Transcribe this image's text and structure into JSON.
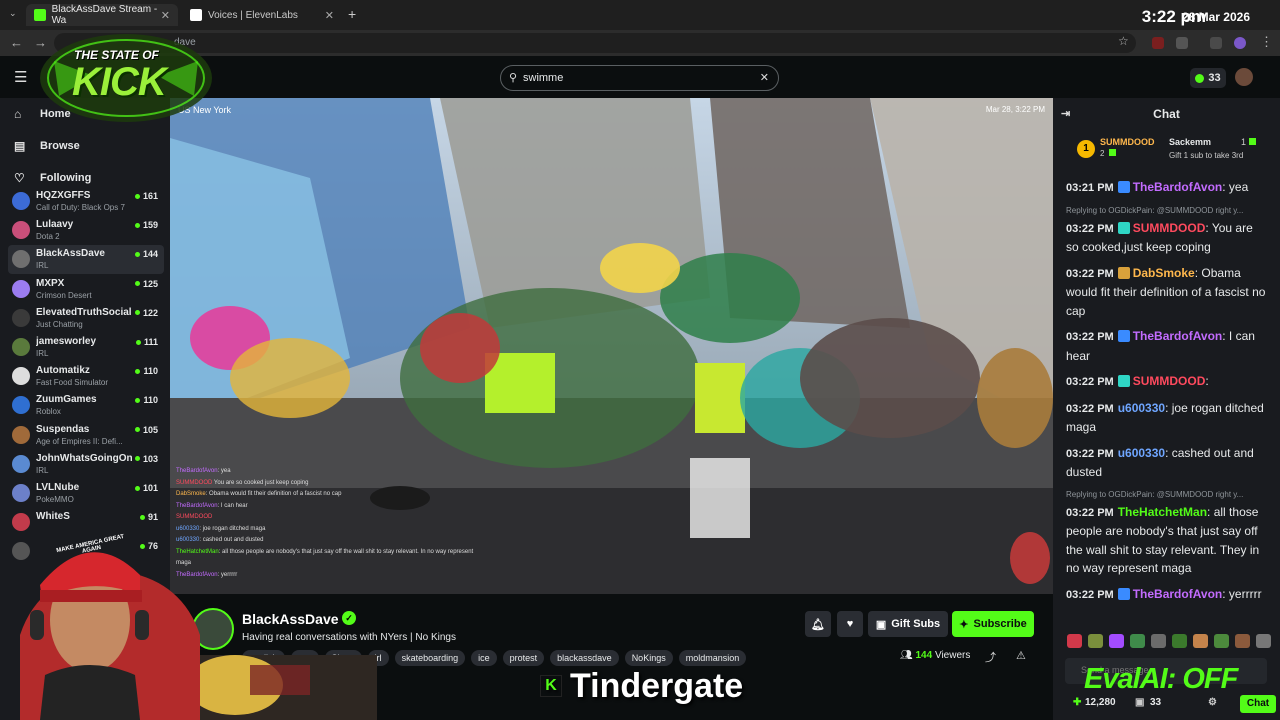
{
  "browser": {
    "tabs": [
      {
        "label": "BlackAssDave Stream - Wa",
        "active": true
      },
      {
        "label": "Voices | ElevenLabs",
        "active": false
      }
    ],
    "new_tab": "+",
    "address_partial": "dave",
    "time": "3:22 pm",
    "date": "28 Mar 2026"
  },
  "logo": {
    "line1": "THE STATE OF",
    "line2": "KICK"
  },
  "topbar": {
    "search_value": "swimme",
    "coins": "33"
  },
  "sidebar": {
    "nav": [
      {
        "label": "Home",
        "icon": "home-icon"
      },
      {
        "label": "Browse",
        "icon": "browse-icon"
      },
      {
        "label": "Following",
        "icon": "heart-icon"
      }
    ],
    "channels": [
      {
        "name": "HQZXGFFS",
        "game": "Call of Duty: Black Ops 7",
        "viewers": "161"
      },
      {
        "name": "Lulaavy",
        "game": "Dota 2",
        "viewers": "159"
      },
      {
        "name": "BlackAssDave",
        "game": "IRL",
        "viewers": "144",
        "active": true
      },
      {
        "name": "MXPX",
        "game": "Crimson Desert",
        "viewers": "125"
      },
      {
        "name": "ElevatedTruthSocial",
        "game": "Just Chatting",
        "viewers": "122"
      },
      {
        "name": "jamesworley",
        "game": "IRL",
        "viewers": "111"
      },
      {
        "name": "Automatikz",
        "game": "Fast Food Simulator",
        "viewers": "110"
      },
      {
        "name": "ZuumGames",
        "game": "Roblox",
        "viewers": "110"
      },
      {
        "name": "Suspendas",
        "game": "Age of Empires II: Defi...",
        "viewers": "105"
      },
      {
        "name": "JohnWhatsGoingOn",
        "game": "IRL",
        "viewers": "103"
      },
      {
        "name": "LVLNube",
        "game": "PokeMMO",
        "viewers": "101"
      },
      {
        "name": "WhiteS",
        "game": "",
        "viewers": "91"
      },
      {
        "name": "",
        "game": "",
        "viewers": "76"
      }
    ]
  },
  "video": {
    "location": "US New York",
    "timestamp": "Mar 28, 3:22 PM",
    "overlay_chat": [
      {
        "user": "TheBardofAvon",
        "text": ": yea"
      },
      {
        "user": "SUMMDOOD",
        "text": " You are so cooked just keep coping"
      },
      {
        "user": "DabSmoke",
        "text": ": Obama would fit their definition of a fascist no cap"
      },
      {
        "user": "TheBardofAvon",
        "text": ": I can hear"
      },
      {
        "user": "SUMMDOOD",
        "text": ""
      },
      {
        "user": "u600330",
        "text": ": joe rogan ditched maga"
      },
      {
        "user": "u600330",
        "text": ": cashed out and dusted"
      },
      {
        "user": "TheHatchetMan",
        "text": ": all those people are nobody's that just say off the wall shit to stay relevant. In no way represent maga"
      },
      {
        "user": "TheBardofAvon",
        "text": ": yerrrrr"
      }
    ]
  },
  "stream": {
    "streamer": "BlackAssDave",
    "title": "Having real conversations with NYers | No Kings",
    "tags": [
      "english",
      "nyc",
      "Skate",
      "irl",
      "skateboarding",
      "ice",
      "protest",
      "blackassdave",
      "NoKings",
      "moldmansion"
    ],
    "viewers": "144",
    "viewers_label": "Viewers",
    "gift_subs": "Gift Subs",
    "subscribe": "Subscribe"
  },
  "caption": {
    "badge": "K",
    "text": "Tindergate"
  },
  "webcam": {
    "hat_text": "MAKE AMERICA GREAT AGAIN"
  },
  "chat": {
    "title": "Chat",
    "leaderboard": {
      "rank": "1",
      "user": "SUMMDOOD",
      "user_count": "2",
      "second_user": "Sackemm",
      "second_count": "1",
      "gift_prompt": "Gift 1 sub to take 3rd"
    },
    "messages": [
      {
        "time": "03:21 PM",
        "user": "TheBardofAvon",
        "text": ": yea",
        "color": "#c36cff",
        "badge": "#3a8bff"
      },
      {
        "time": "03:22 PM",
        "user": "SUMMDOOD",
        "text": ": You are so cooked,just keep coping",
        "color": "#ff4a5e",
        "badge": "#2fd6c5",
        "reply": "Replying to OGDickPain: @SUMMDOOD right y..."
      },
      {
        "time": "03:22 PM",
        "user": "DabSmoke",
        "text": ": Obama would fit their definition of a fascist no cap",
        "color": "#ffb84d",
        "badge": "#d9a13b"
      },
      {
        "time": "03:22 PM",
        "user": "TheBardofAvon",
        "text": ": I can hear",
        "color": "#c36cff",
        "badge": "#3a8bff"
      },
      {
        "time": "03:22 PM",
        "user": "SUMMDOOD",
        "text": ":",
        "color": "#ff4a5e",
        "badge": "#2fd6c5"
      },
      {
        "time": "03:22 PM",
        "user": "u600330",
        "text": ": joe rogan ditched maga",
        "color": "#6fa6ff",
        "badge": ""
      },
      {
        "time": "03:22 PM",
        "user": "u600330",
        "text": ": cashed out and dusted",
        "color": "#6fa6ff",
        "badge": ""
      },
      {
        "time": "03:22 PM",
        "user": "TheHatchetMan",
        "text": ": all those people are nobody's that just say off the wall shit to stay relevant. They in no way represent maga",
        "color": "#53fc18",
        "badge": "",
        "reply": "Replying to OGDickPain: @SUMMDOOD right y..."
      },
      {
        "time": "03:22 PM",
        "user": "TheBardofAvon",
        "text": ": yerrrrr",
        "color": "#c36cff",
        "badge": "#3a8bff"
      }
    ],
    "send_placeholder": "Send a message",
    "points": "12,280",
    "gifts": "33",
    "chat_button": "Chat"
  },
  "overlay_label": "EvalAI: OFF"
}
